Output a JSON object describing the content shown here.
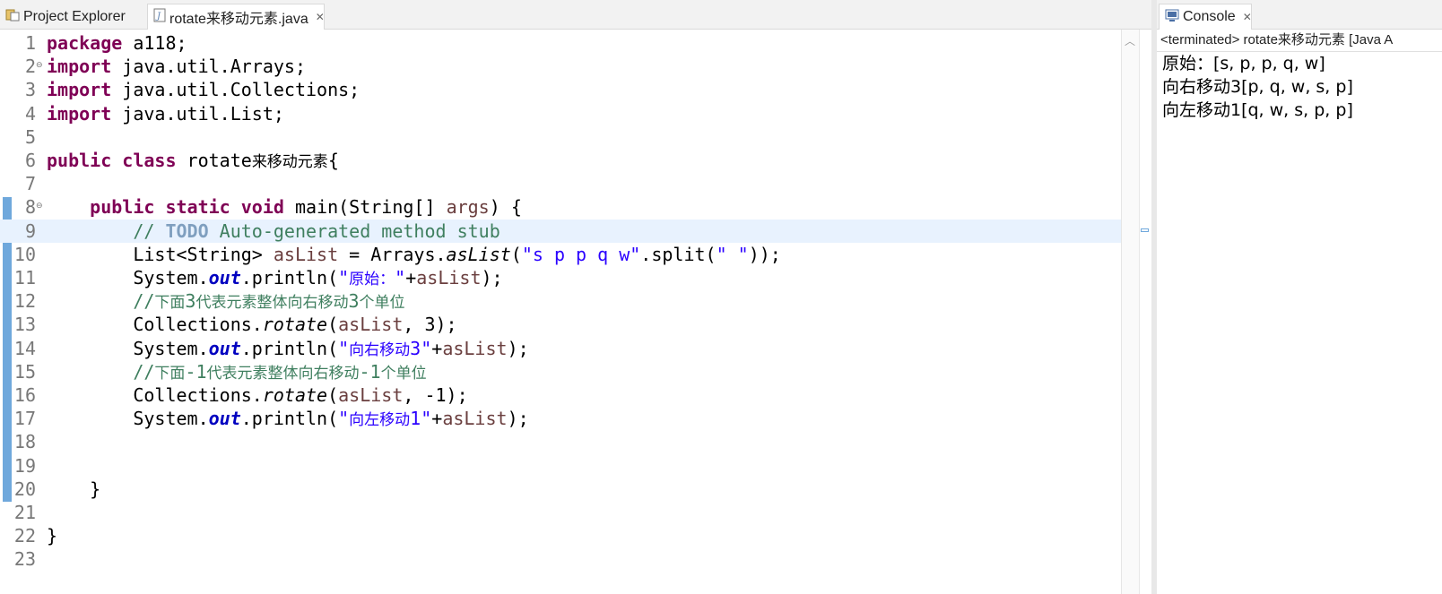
{
  "tabs": {
    "project_explorer": "Project Explorer",
    "editor_file": "rotate来移动元素.java"
  },
  "console": {
    "tab_label": "Console",
    "status": "<terminated> rotate来移动元素 [Java A",
    "output": [
      "原始：[s, p, p, q, w]",
      "向右移动3[p, q, w, s, p]",
      "向左移动1[q, w, s, p, p]"
    ]
  },
  "editor": {
    "current_line": 9,
    "lines": [
      {
        "n": "1",
        "tokens": [
          {
            "t": "kw",
            "v": "package"
          },
          {
            "t": "",
            "v": " a118;"
          }
        ]
      },
      {
        "n": "2",
        "fold": true,
        "tokens": [
          {
            "t": "kw",
            "v": "import"
          },
          {
            "t": "",
            "v": " java.util.Arrays;"
          }
        ]
      },
      {
        "n": "3",
        "tokens": [
          {
            "t": "kw",
            "v": "import"
          },
          {
            "t": "",
            "v": " java.util.Collections;"
          }
        ]
      },
      {
        "n": "4",
        "tokens": [
          {
            "t": "kw",
            "v": "import"
          },
          {
            "t": "",
            "v": " java.util.List;"
          }
        ]
      },
      {
        "n": "5",
        "tokens": []
      },
      {
        "n": "6",
        "tokens": [
          {
            "t": "kw",
            "v": "public"
          },
          {
            "t": "",
            "v": " "
          },
          {
            "t": "kw",
            "v": "class"
          },
          {
            "t": "",
            "v": " rotate"
          },
          {
            "t": "cjk",
            "v": "来移动元素"
          },
          {
            "t": "",
            "v": "{"
          }
        ]
      },
      {
        "n": "7",
        "tokens": []
      },
      {
        "n": "8",
        "fold": true,
        "tokens": [
          {
            "t": "",
            "v": "    "
          },
          {
            "t": "kw",
            "v": "public"
          },
          {
            "t": "",
            "v": " "
          },
          {
            "t": "kw",
            "v": "static"
          },
          {
            "t": "",
            "v": " "
          },
          {
            "t": "kw",
            "v": "void"
          },
          {
            "t": "",
            "v": " main(String[] "
          },
          {
            "t": "var",
            "v": "args"
          },
          {
            "t": "",
            "v": ") {"
          }
        ]
      },
      {
        "n": "9",
        "tokens": [
          {
            "t": "",
            "v": "        "
          },
          {
            "t": "cm",
            "v": "// "
          },
          {
            "t": "todo",
            "v": "TODO"
          },
          {
            "t": "cm",
            "v": " Auto-generated method stub"
          }
        ]
      },
      {
        "n": "10",
        "tokens": [
          {
            "t": "",
            "v": "        List<String> "
          },
          {
            "t": "var",
            "v": "asList"
          },
          {
            "t": "",
            "v": " = Arrays."
          },
          {
            "t": "it",
            "v": "asList"
          },
          {
            "t": "",
            "v": "("
          },
          {
            "t": "str",
            "v": "\"s p p q w\""
          },
          {
            "t": "",
            "v": ".split("
          },
          {
            "t": "str",
            "v": "\" \""
          },
          {
            "t": "",
            "v": "));"
          }
        ]
      },
      {
        "n": "11",
        "tokens": [
          {
            "t": "",
            "v": "        System."
          },
          {
            "t": "fld",
            "v": "out"
          },
          {
            "t": "",
            "v": ".println("
          },
          {
            "t": "str",
            "v": "\"原始：\""
          },
          {
            "t": "",
            "v": "+"
          },
          {
            "t": "var",
            "v": "asList"
          },
          {
            "t": "",
            "v": ");"
          }
        ]
      },
      {
        "n": "12",
        "tokens": [
          {
            "t": "",
            "v": "        "
          },
          {
            "t": "cm",
            "v": "//下面3代表元素整体向右移动3个单位"
          }
        ]
      },
      {
        "n": "13",
        "tokens": [
          {
            "t": "",
            "v": "        Collections."
          },
          {
            "t": "it",
            "v": "rotate"
          },
          {
            "t": "",
            "v": "("
          },
          {
            "t": "var",
            "v": "asList"
          },
          {
            "t": "",
            "v": ", 3);"
          }
        ]
      },
      {
        "n": "14",
        "tokens": [
          {
            "t": "",
            "v": "        System."
          },
          {
            "t": "fld",
            "v": "out"
          },
          {
            "t": "",
            "v": ".println("
          },
          {
            "t": "str",
            "v": "\"向右移动3\""
          },
          {
            "t": "",
            "v": "+"
          },
          {
            "t": "var",
            "v": "asList"
          },
          {
            "t": "",
            "v": ");"
          }
        ]
      },
      {
        "n": "15",
        "tokens": [
          {
            "t": "",
            "v": "        "
          },
          {
            "t": "cm",
            "v": "//下面-1代表元素整体向右移动-1个单位"
          }
        ]
      },
      {
        "n": "16",
        "tokens": [
          {
            "t": "",
            "v": "        Collections."
          },
          {
            "t": "it",
            "v": "rotate"
          },
          {
            "t": "",
            "v": "("
          },
          {
            "t": "var",
            "v": "asList"
          },
          {
            "t": "",
            "v": ", -1);"
          }
        ]
      },
      {
        "n": "17",
        "tokens": [
          {
            "t": "",
            "v": "        System."
          },
          {
            "t": "fld",
            "v": "out"
          },
          {
            "t": "",
            "v": ".println("
          },
          {
            "t": "str",
            "v": "\"向左移动1\""
          },
          {
            "t": "",
            "v": "+"
          },
          {
            "t": "var",
            "v": "asList"
          },
          {
            "t": "",
            "v": ");"
          }
        ]
      },
      {
        "n": "18",
        "tokens": []
      },
      {
        "n": "19",
        "tokens": []
      },
      {
        "n": "20",
        "tokens": [
          {
            "t": "",
            "v": "    }"
          }
        ]
      },
      {
        "n": "21",
        "tokens": []
      },
      {
        "n": "22",
        "tokens": [
          {
            "t": "",
            "v": "}"
          }
        ]
      },
      {
        "n": "23",
        "tokens": []
      }
    ]
  }
}
